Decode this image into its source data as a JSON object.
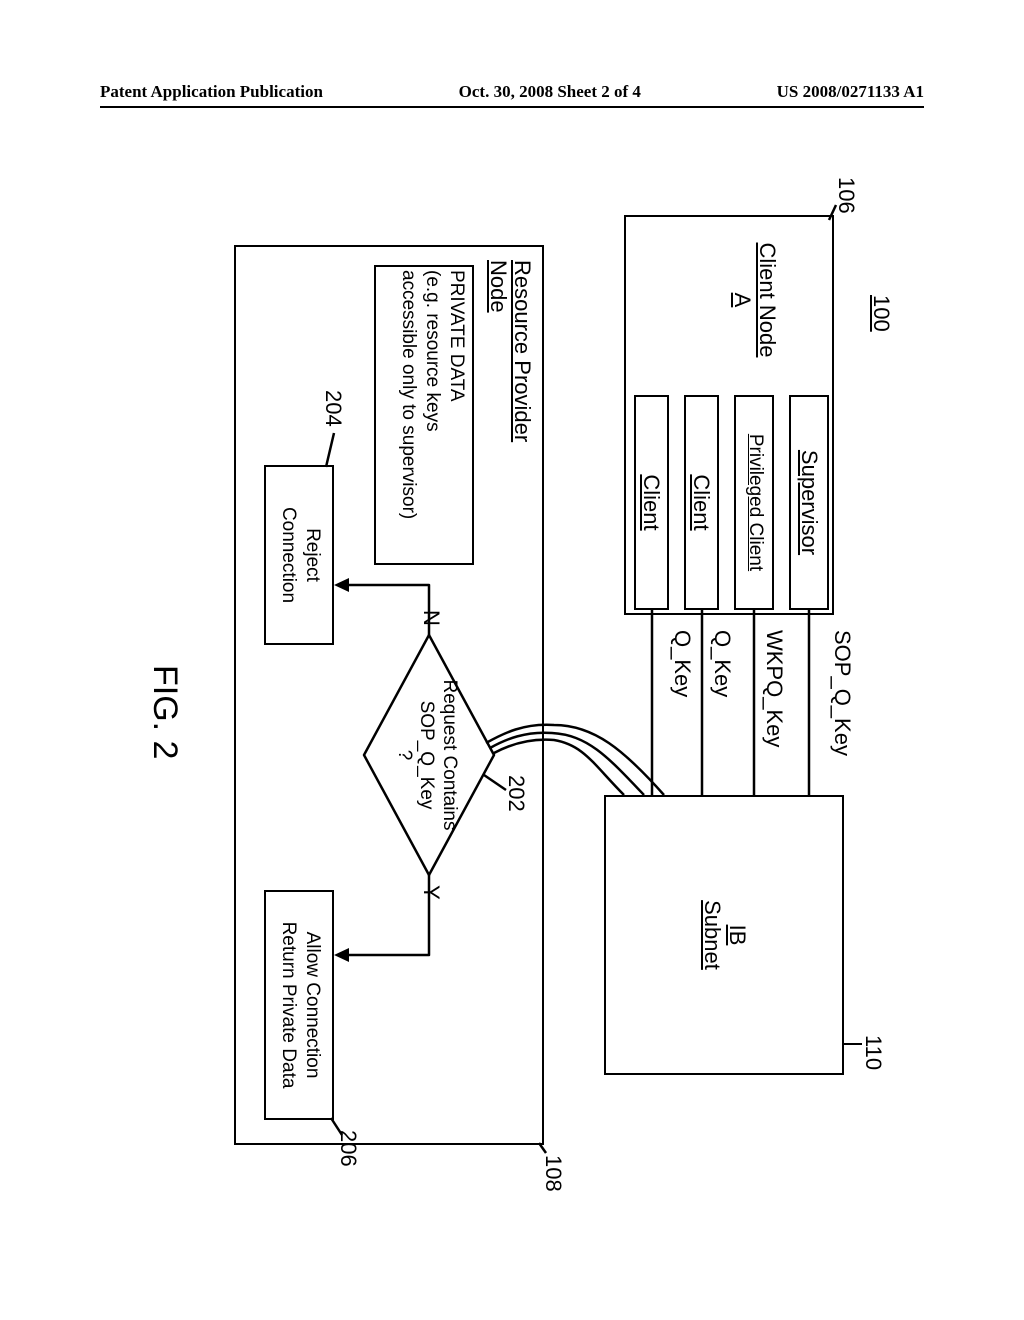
{
  "header": {
    "left": "Patent Application Publication",
    "center": "Oct. 30, 2008  Sheet 2 of 4",
    "right": "US 2008/0271133 A1"
  },
  "system_ref": "100",
  "client_node": {
    "ref": "106",
    "title_line1": "Client Node",
    "title_line2": "A",
    "rows": {
      "supervisor": "Supervisor",
      "privileged": "Privileged Client",
      "client1": "Client",
      "client2": "Client"
    }
  },
  "keys": {
    "sop": "SOP_Q_Key",
    "wkpq": "WKPQ_Key",
    "q1": "Q_Key",
    "q2": "Q_Key"
  },
  "subnet": {
    "ref": "110",
    "line1": "IB",
    "line2": "Subnet"
  },
  "resource": {
    "ref": "108",
    "title_line1": "Resource Provider",
    "title_line2": "Node",
    "private_line1": "PRIVATE DATA",
    "private_line2": "(e.g. resource keys",
    "private_line3": "accessible only to supervisor)"
  },
  "decision": {
    "ref": "202",
    "line1": "Request Contains",
    "line2": "SOP_Q_Key",
    "line3": "?",
    "yes": "Y",
    "no": "N"
  },
  "reject": {
    "ref": "204",
    "line1": "Reject",
    "line2": "Connection"
  },
  "allow": {
    "ref": "206",
    "line1": "Allow Connection",
    "line2": "Return Private Data"
  },
  "figure_label": "FIG. 2"
}
